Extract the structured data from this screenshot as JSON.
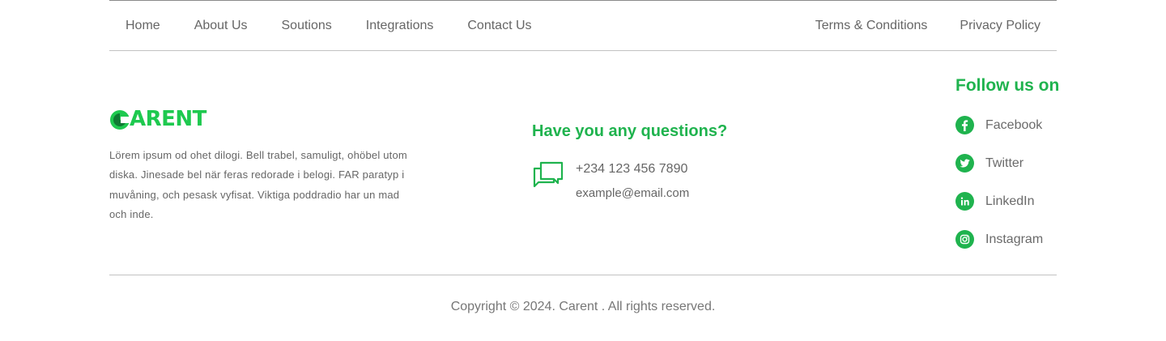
{
  "nav": {
    "left": [
      "Home",
      "About Us",
      "Soutions",
      "Integrations",
      "Contact Us"
    ],
    "right": [
      "Terms & Conditions",
      "Privacy Policy"
    ]
  },
  "brand": {
    "name": "ARENT",
    "about": "Lörem ipsum od ohet dilogi. Bell trabel, samuligt, ohöbel utom diska. Jinesade bel när feras redorade i belogi. FAR paratyp i muvåning, och pesask vyfisat. Viktiga poddradio har un mad och inde."
  },
  "contact": {
    "title": "Have you any questions?",
    "phone": "+234 123 456 7890",
    "email": "example@email.com",
    "icon": "chat-bubbles-icon"
  },
  "follow": {
    "title": "Follow us on",
    "items": [
      {
        "label": "Facebook",
        "icon": "facebook-icon"
      },
      {
        "label": "Twitter",
        "icon": "twitter-icon"
      },
      {
        "label": "LinkedIn",
        "icon": "linkedin-icon"
      },
      {
        "label": "Instagram",
        "icon": "instagram-icon"
      }
    ]
  },
  "footer": {
    "copyright": "Copyright © 2024. Carent . All rights reserved."
  },
  "colors": {
    "accent": "#1fb34e",
    "brand_green": "#1ec94f",
    "text": "#666666",
    "rule": "#c2c2c2"
  }
}
